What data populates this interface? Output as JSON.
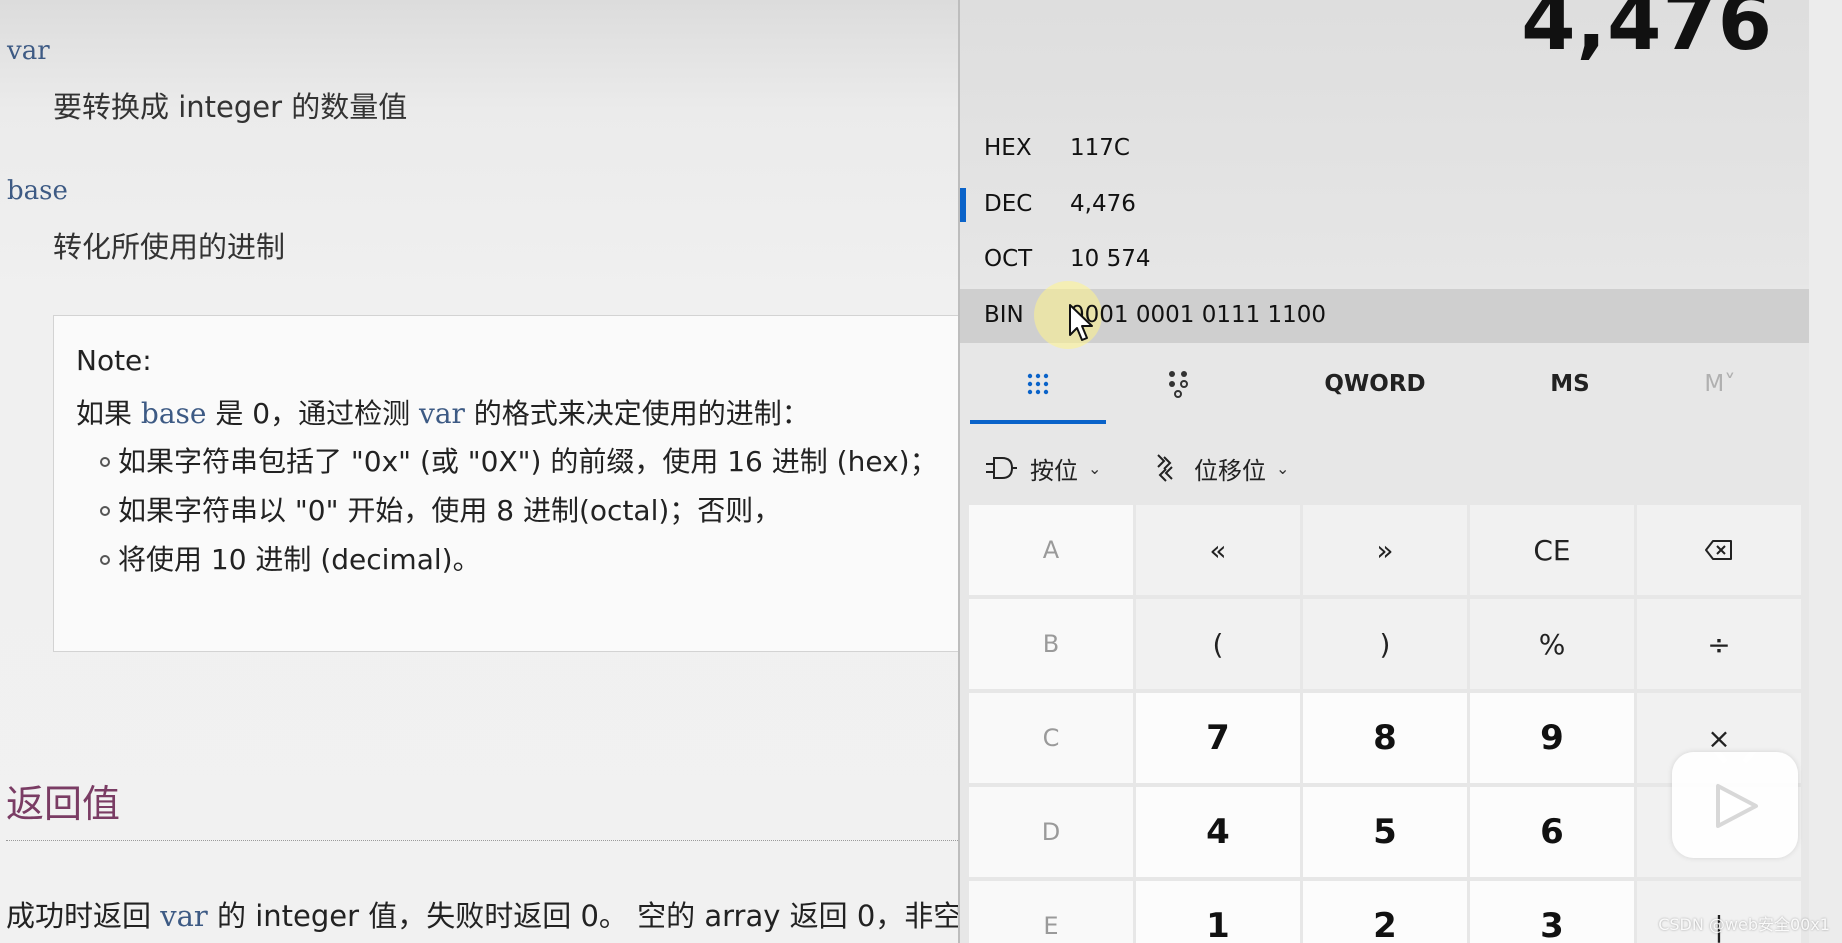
{
  "doc": {
    "param1": {
      "name": "var",
      "desc": "要转换成 integer 的数量值"
    },
    "param2": {
      "name": "base",
      "desc": "转化所使用的进制"
    },
    "note": {
      "title": "Note:",
      "line1_a": "如果 ",
      "line1_code1": "base",
      "line1_b": " 是 0，通过检测 ",
      "line1_code2": "var",
      "line1_c": " 的格式来决定使用的进制：",
      "bullets": [
        "如果字符串包括了 \"0x\" (或 \"0X\") 的前缀，使用 16 进制 (hex)；",
        "如果字符串以 \"0\" 开始，使用 8 进制(octal)；否则，",
        "将使用 10 进制 (decimal)。"
      ]
    },
    "return_title": "返回值",
    "return_text_a": "成功时返回 ",
    "return_text_code": "var",
    "return_text_b": " 的 integer 值，失败时返回 0。 空的 array 返回 0，非空"
  },
  "calc": {
    "display": "4,476",
    "radix": [
      {
        "label": "HEX",
        "value": "117C"
      },
      {
        "label": "DEC",
        "value": "4,476"
      },
      {
        "label": "OCT",
        "value": "10 574"
      },
      {
        "label": "BIN",
        "value": "0001 0001 0111 1100"
      }
    ],
    "modes": {
      "word_size": "QWORD",
      "memory_store": "MS",
      "memory_recall": "M˅"
    },
    "ops": {
      "bitwise": "按位",
      "bitshift": "位移位"
    },
    "keys": [
      [
        "A",
        "«",
        "»",
        "CE",
        "⌫"
      ],
      [
        "B",
        "(",
        ")",
        "%",
        "÷"
      ],
      [
        "C",
        "7",
        "8",
        "9",
        "×"
      ],
      [
        "D",
        "4",
        "5",
        "6",
        ""
      ],
      [
        "E",
        "1",
        "2",
        "3",
        "|"
      ]
    ]
  },
  "watermark": "CSDN @web安全00x1"
}
